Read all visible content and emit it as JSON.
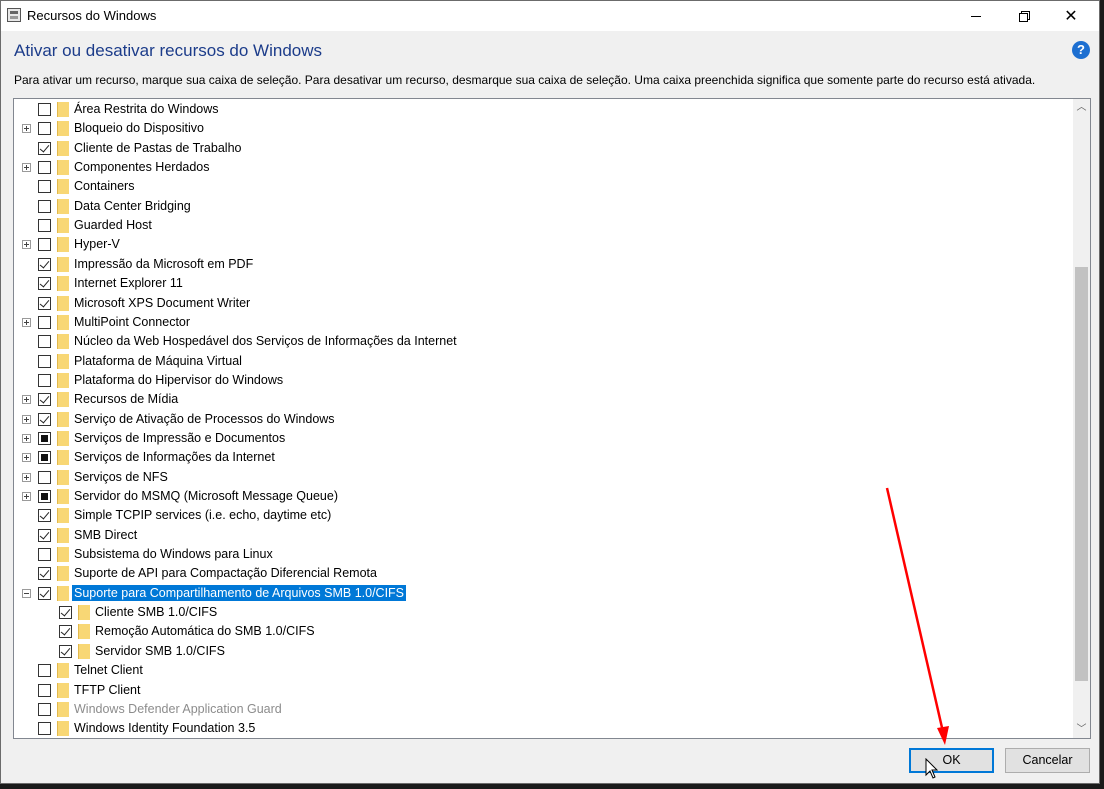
{
  "window": {
    "title": "Recursos do Windows",
    "heading": "Ativar ou desativar recursos do Windows",
    "description": "Para ativar um recurso, marque sua caixa de seleção. Para desativar um recurso, desmarque sua caixa de seleção. Uma caixa preenchida significa que somente parte do recurso está ativada.",
    "help_glyph": "?",
    "close_glyph": "✕"
  },
  "features": [
    {
      "label": "Área Restrita do Windows",
      "state": "unchecked",
      "expander": "none",
      "level": 0
    },
    {
      "label": "Bloqueio do Dispositivo",
      "state": "unchecked",
      "expander": "plus",
      "level": 0
    },
    {
      "label": "Cliente de Pastas de Trabalho",
      "state": "checked",
      "expander": "none",
      "level": 0
    },
    {
      "label": "Componentes Herdados",
      "state": "unchecked",
      "expander": "plus",
      "level": 0
    },
    {
      "label": "Containers",
      "state": "unchecked",
      "expander": "none",
      "level": 0
    },
    {
      "label": "Data Center Bridging",
      "state": "unchecked",
      "expander": "none",
      "level": 0
    },
    {
      "label": "Guarded Host",
      "state": "unchecked",
      "expander": "none",
      "level": 0
    },
    {
      "label": "Hyper-V",
      "state": "unchecked",
      "expander": "plus",
      "level": 0
    },
    {
      "label": "Impressão da Microsoft em PDF",
      "state": "checked",
      "expander": "none",
      "level": 0
    },
    {
      "label": "Internet Explorer 11",
      "state": "checked",
      "expander": "none",
      "level": 0
    },
    {
      "label": "Microsoft XPS Document Writer",
      "state": "checked",
      "expander": "none",
      "level": 0
    },
    {
      "label": "MultiPoint Connector",
      "state": "unchecked",
      "expander": "plus",
      "level": 0
    },
    {
      "label": "Núcleo da Web Hospedável dos Serviços de Informações da Internet",
      "state": "unchecked",
      "expander": "none",
      "level": 0
    },
    {
      "label": "Plataforma de Máquina Virtual",
      "state": "unchecked",
      "expander": "none",
      "level": 0
    },
    {
      "label": "Plataforma do Hipervisor do Windows",
      "state": "unchecked",
      "expander": "none",
      "level": 0
    },
    {
      "label": "Recursos de Mídia",
      "state": "checked",
      "expander": "plus",
      "level": 0
    },
    {
      "label": "Serviço de Ativação de Processos do Windows",
      "state": "checked",
      "expander": "plus",
      "level": 0
    },
    {
      "label": "Serviços de Impressão e Documentos",
      "state": "partial",
      "expander": "plus",
      "level": 0
    },
    {
      "label": "Serviços de Informações da Internet",
      "state": "partial",
      "expander": "plus",
      "level": 0
    },
    {
      "label": "Serviços de NFS",
      "state": "unchecked",
      "expander": "plus",
      "level": 0
    },
    {
      "label": "Servidor do MSMQ (Microsoft Message Queue)",
      "state": "partial",
      "expander": "plus",
      "level": 0
    },
    {
      "label": "Simple TCPIP services (i.e. echo, daytime etc)",
      "state": "checked",
      "expander": "none",
      "level": 0
    },
    {
      "label": "SMB Direct",
      "state": "checked",
      "expander": "none",
      "level": 0
    },
    {
      "label": "Subsistema do Windows para Linux",
      "state": "unchecked",
      "expander": "none",
      "level": 0
    },
    {
      "label": "Suporte de API para Compactação Diferencial Remota",
      "state": "checked",
      "expander": "none",
      "level": 0
    },
    {
      "label": "Suporte para Compartilhamento de Arquivos SMB 1.0/CIFS",
      "state": "checked",
      "expander": "minus",
      "level": 0,
      "selected": true
    },
    {
      "label": "Cliente SMB 1.0/CIFS",
      "state": "checked",
      "expander": "none",
      "level": 1
    },
    {
      "label": "Remoção Automática do SMB 1.0/CIFS",
      "state": "checked",
      "expander": "none",
      "level": 1
    },
    {
      "label": "Servidor SMB 1.0/CIFS",
      "state": "checked",
      "expander": "none",
      "level": 1
    },
    {
      "label": "Telnet Client",
      "state": "unchecked",
      "expander": "none",
      "level": 0
    },
    {
      "label": "TFTP Client",
      "state": "unchecked",
      "expander": "none",
      "level": 0
    },
    {
      "label": "Windows Defender Application Guard",
      "state": "unchecked",
      "expander": "none",
      "level": 0,
      "disabled": true
    },
    {
      "label": "Windows Identity Foundation 3.5",
      "state": "unchecked",
      "expander": "none",
      "level": 0
    }
  ],
  "scroll": {
    "up_glyph": "︿",
    "down_glyph": "﹀"
  },
  "buttons": {
    "ok": "OK",
    "cancel": "Cancelar"
  },
  "colors": {
    "selection": "#0078d7",
    "heading": "#1c3c8a",
    "annotation_arrow": "#ff0000",
    "folder": "#f8d775"
  }
}
